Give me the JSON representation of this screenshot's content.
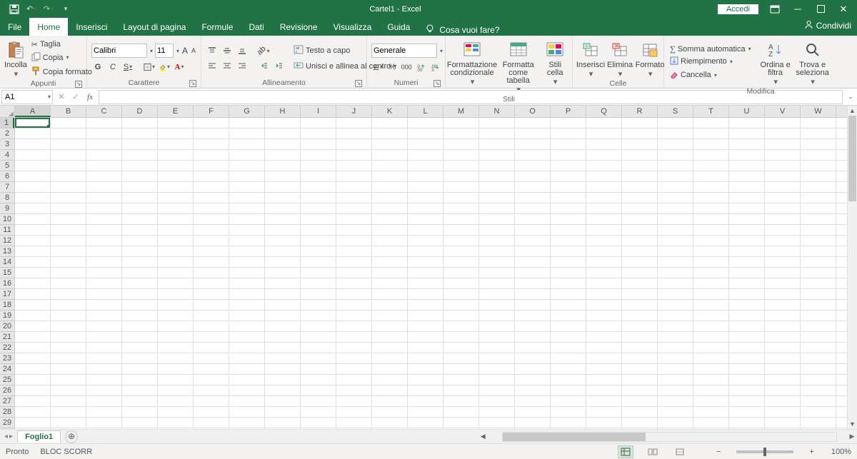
{
  "title": "Cartel1  -  Excel",
  "signin": "Accedi",
  "share": "Condividi",
  "tabs": [
    "File",
    "Home",
    "Inserisci",
    "Layout di pagina",
    "Formule",
    "Dati",
    "Revisione",
    "Visualizza",
    "Guida"
  ],
  "tell": "Cosa vuoi fare?",
  "clipboard": {
    "paste": "Incolla",
    "cut": "Taglia",
    "copy": "Copia",
    "format_painter": "Copia formato",
    "group": "Appunti"
  },
  "font": {
    "name": "Calibri",
    "size": "11",
    "bold": "G",
    "italic": "C",
    "underline": "S",
    "incr": "A",
    "decr": "A",
    "group": "Carattere"
  },
  "alignment": {
    "wrap": "Testo a capo",
    "merge": "Unisci e allinea al centro",
    "group": "Allineamento"
  },
  "number": {
    "format": "Generale",
    "group": "Numeri"
  },
  "styles": {
    "cf": "Formattazione condizionale",
    "ft": "Formatta come tabella",
    "cs": "Stili cella",
    "group": "Stili"
  },
  "cells": {
    "insert": "Inserisci",
    "delete": "Elimina",
    "format": "Formato",
    "group": "Celle"
  },
  "editing": {
    "sum": "Somma automatica",
    "fill": "Riempimento",
    "clear": "Cancella",
    "sort": "Ordina e filtra",
    "find": "Trova e seleziona",
    "group": "Modifica"
  },
  "namebox": "A1",
  "columns": [
    "A",
    "B",
    "C",
    "D",
    "E",
    "F",
    "G",
    "H",
    "I",
    "J",
    "K",
    "L",
    "M",
    "N",
    "O",
    "P",
    "Q",
    "R",
    "S",
    "T",
    "U",
    "V",
    "W"
  ],
  "rows_count": 29,
  "sheet": "Foglio1",
  "status_ready": "Pronto",
  "status_scroll": "BLOC SCORR",
  "zoom": "100%"
}
